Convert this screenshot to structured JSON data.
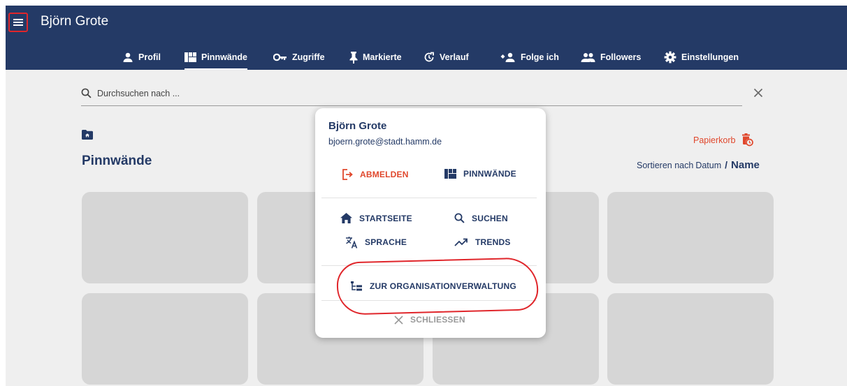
{
  "app": {
    "title": "Björn Grote"
  },
  "nav": {
    "tabs": [
      {
        "label": "Profil",
        "icon": "person-icon"
      },
      {
        "label": "Pinnwände",
        "icon": "dashboard-icon",
        "active": true
      },
      {
        "label": "Zugriffe",
        "icon": "key-icon"
      },
      {
        "label": "Markierte",
        "icon": "pin-icon"
      },
      {
        "label": "Verlauf",
        "icon": "history-icon"
      },
      {
        "label": "Folge ich",
        "icon": "follow-icon"
      },
      {
        "label": "Followers",
        "icon": "group-icon"
      },
      {
        "label": "Einstellungen",
        "icon": "gear-icon"
      }
    ]
  },
  "search": {
    "placeholder": "Durchsuchen nach ...",
    "value": ""
  },
  "page": {
    "title": "Pinnwände",
    "trash_label": "Papierkorb",
    "sort": {
      "prefix": "Sortieren nach",
      "option_date": "Datum",
      "separator": "/",
      "option_name": "Name",
      "active": "Name"
    }
  },
  "popup": {
    "user_name": "Björn Grote",
    "user_email": "bjoern.grote@stadt.hamm.de",
    "logout_label": "ABMELDEN",
    "boards_label": "PINNWÄNDE",
    "home_label": "STARTSEITE",
    "search_label": "SUCHEN",
    "language_label": "SPRACHE",
    "trends_label": "TRENDS",
    "org_label": "ZUR ORGANISATIONVERWALTUNG",
    "close_label": "SCHLIESSEN"
  },
  "colors": {
    "appbar": "#243a66",
    "accent": "#243a66",
    "danger": "#e0472c",
    "annotation": "#e0262b",
    "placeholder_card": "#d6d6d6",
    "background": "#efefef"
  }
}
